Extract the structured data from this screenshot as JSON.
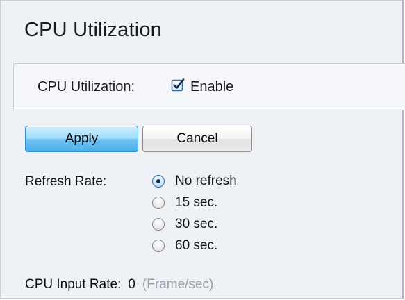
{
  "page": {
    "title": "CPU Utilization"
  },
  "settings": {
    "cpu_label": "CPU Utilization:",
    "enable_label": "Enable",
    "enable_checked": true
  },
  "buttons": {
    "apply": "Apply",
    "cancel": "Cancel"
  },
  "refresh": {
    "label": "Refresh Rate:",
    "options": [
      {
        "label": "No refresh",
        "selected": true
      },
      {
        "label": "15 sec.",
        "selected": false
      },
      {
        "label": "30 sec.",
        "selected": false
      },
      {
        "label": "60 sec.",
        "selected": false
      }
    ]
  },
  "input_rate": {
    "label": "CPU Input Rate:",
    "value": "0",
    "unit": "(Frame/sec)"
  },
  "colors": {
    "background": "#eef2f7",
    "apply_button": "#6fc2f2",
    "unit_text": "#9aa0a8"
  }
}
